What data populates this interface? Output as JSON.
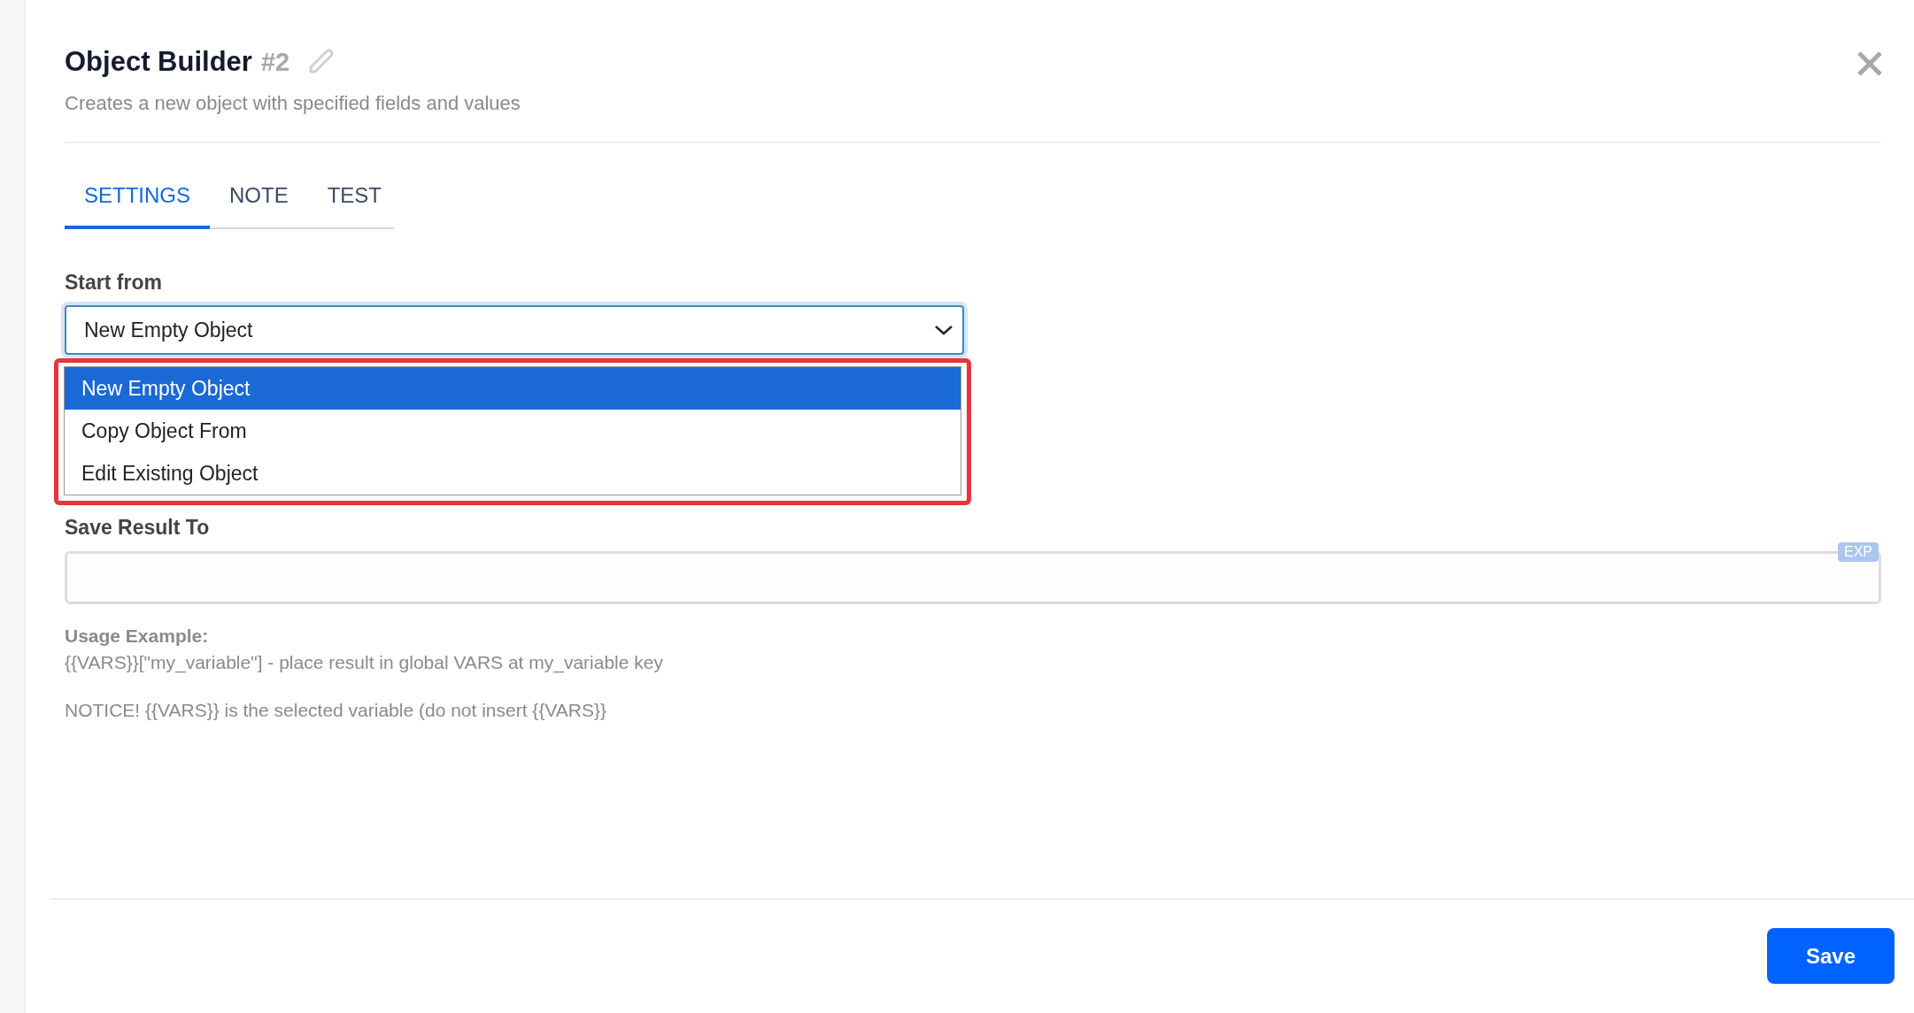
{
  "header": {
    "title": "Object Builder",
    "number": "#2",
    "subtitle": "Creates a new object with specified fields and values"
  },
  "tabs": [
    {
      "label": "SETTINGS",
      "selected": true
    },
    {
      "label": "NOTE",
      "selected": false
    },
    {
      "label": "TEST",
      "selected": false
    }
  ],
  "start_from": {
    "label": "Start from",
    "value": "New Empty Object",
    "expanded": true,
    "highlighted": true,
    "options": [
      {
        "label": "New Empty Object",
        "selected": true
      },
      {
        "label": "Copy Object From",
        "selected": false
      },
      {
        "label": "Edit Existing Object",
        "selected": false
      }
    ]
  },
  "save_result": {
    "label": "Save Result To",
    "badge": "EXP"
  },
  "usage": {
    "heading": "Usage Example:",
    "example": "{{VARS}}[\"my_variable\"] - place result in global VARS at my_variable key",
    "notice": "NOTICE! {{VARS}} is the selected variable (do not insert {{VARS}}"
  },
  "save_button": "Save"
}
